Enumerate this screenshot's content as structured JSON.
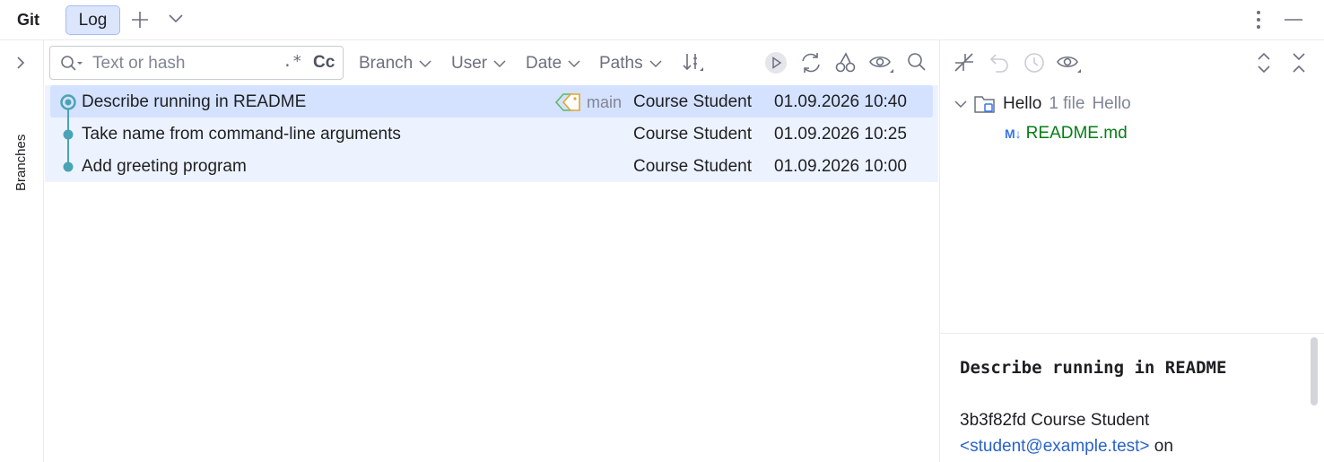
{
  "toolwindow": {
    "title": "Git",
    "tabs": [
      {
        "label": "Log",
        "active": true
      }
    ]
  },
  "sidebar": {
    "label": "Branches"
  },
  "search": {
    "placeholder": "Text or hash",
    "value": "",
    "regex_label": ".*",
    "case_label": "Cc"
  },
  "filters": [
    {
      "label": "Branch"
    },
    {
      "label": "User"
    },
    {
      "label": "Date"
    },
    {
      "label": "Paths"
    }
  ],
  "toolbar_icons": [
    "sort-icon",
    "run-icon",
    "refresh-icon",
    "cherry-pick-icon",
    "eye-icon",
    "search-icon"
  ],
  "commits": [
    {
      "subject": "Describe running in README",
      "ref": "main",
      "author": "Course Student",
      "date": "01.09.2026 10:40",
      "selected": true
    },
    {
      "subject": "Take name from command-line arguments",
      "ref": "",
      "author": "Course Student",
      "date": "01.09.2026 10:25",
      "selected": false
    },
    {
      "subject": "Add greeting program",
      "ref": "",
      "author": "Course Student",
      "date": "01.09.2026 10:00",
      "selected": false
    }
  ],
  "changes": {
    "root": {
      "name": "Hello",
      "count": "1 file",
      "module": "Hello"
    },
    "files": [
      {
        "badge": "M↓",
        "name": "README.md"
      }
    ]
  },
  "details": {
    "message": "Describe running in README",
    "hash_author": "3b3f82fd Course Student",
    "email": "<student@example.test>",
    "email_suffix": " on"
  },
  "colors": {
    "accent": "#3574f0",
    "selected_row": "#d4e2ff",
    "branch_rows": "#edf3fe",
    "graph": "#4aa3b5",
    "modified_file": "#067d17",
    "link": "#2a62c9"
  }
}
